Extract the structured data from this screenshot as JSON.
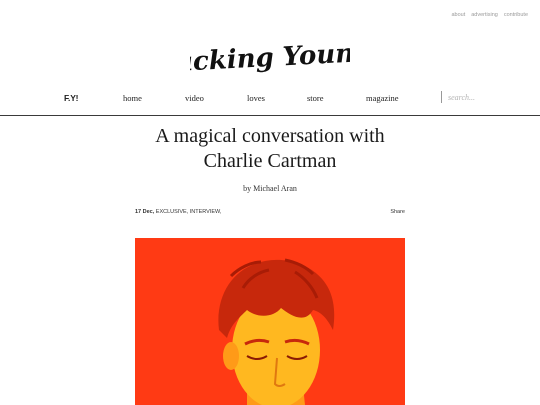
{
  "top_links": [
    "about",
    "advertising",
    "contribute"
  ],
  "logo": {
    "text": "Fucking Young!"
  },
  "nav": {
    "brand": "F.Y!",
    "items": [
      "home",
      "video",
      "loves",
      "store",
      "magazine"
    ],
    "search_placeholder": "search..."
  },
  "article": {
    "title_line1": "A magical conversation with",
    "title_line2": "Charlie Cartman",
    "byline": "by Michael Aran",
    "date": "17 Dec,",
    "categories": "EXCLUSIVE, INTERVIEW,",
    "share_label": "Share"
  },
  "colors": {
    "hero_background": "#ff3a14",
    "hero_skin": "#ffb820",
    "hero_hair": "#c7280c"
  }
}
